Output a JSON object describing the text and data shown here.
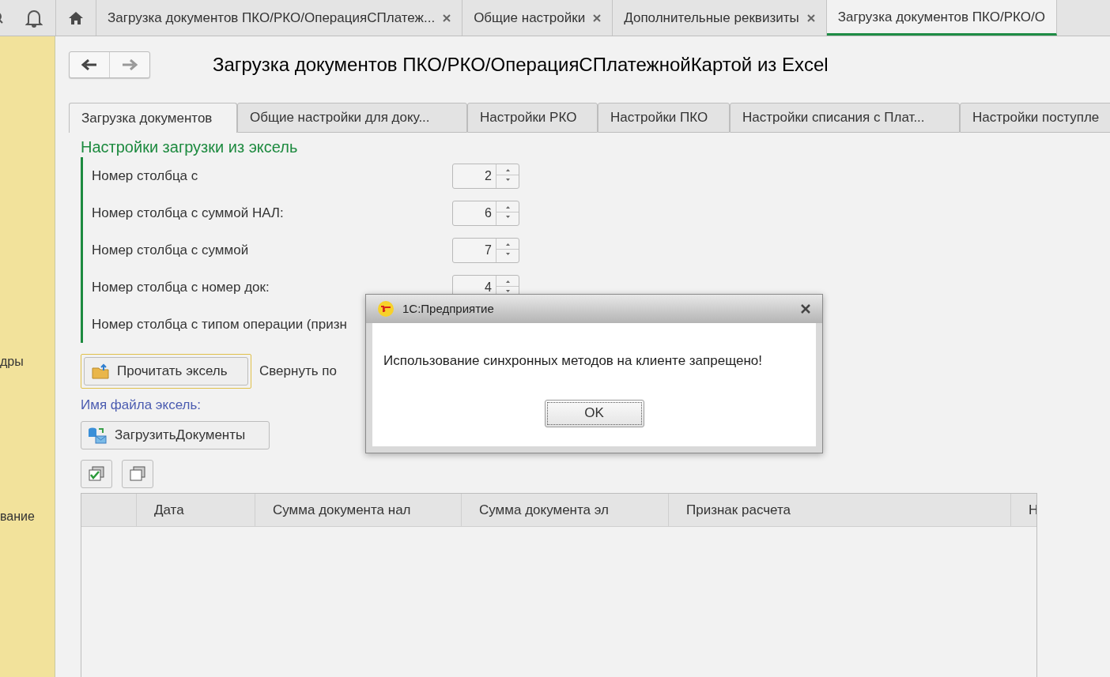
{
  "top_tabs": [
    {
      "label": "Загрузка документов ПКО/РКО/ОперацияСПлатеж...",
      "closable": true,
      "selected": false
    },
    {
      "label": "Общие настройки",
      "closable": true,
      "selected": false
    },
    {
      "label": "Дополнительные реквизиты",
      "closable": true,
      "selected": false
    },
    {
      "label": "Загрузка документов ПКО/РКО/О",
      "closable": false,
      "selected": true
    }
  ],
  "sidebar": {
    "items": [
      "дры",
      "вание"
    ]
  },
  "form": {
    "title": "Загрузка документов ПКО/РКО/ОперацияСПлатежнойКартой из Excel",
    "tabs": [
      {
        "label": "Загрузка документов",
        "selected": true
      },
      {
        "label": "Общие настройки для доку...",
        "selected": false
      },
      {
        "label": "Настройки РКО",
        "selected": false
      },
      {
        "label": "Настройки ПКО",
        "selected": false
      },
      {
        "label": "Настройки списания с Плат...",
        "selected": false
      },
      {
        "label": "Настройки поступле",
        "selected": false
      }
    ],
    "section_title": "Настройки загрузки из эксель",
    "fields": [
      {
        "label": "Номер столбца с",
        "value": "2"
      },
      {
        "label": "Номер столбца с суммой НАЛ:",
        "value": "6"
      },
      {
        "label": "Номер столбца с суммой",
        "value": "7"
      },
      {
        "label": "Номер столбца с номер док:",
        "value": "4"
      },
      {
        "label": "Номер столбца с типом операции (призн"
      }
    ],
    "read_button": {
      "label": "Прочитать эксель",
      "focused": true
    },
    "collapse_label": "Свернуть по",
    "file_label": "Имя файла эксель:",
    "load_button": "ЗагрузитьДокументы",
    "table": {
      "columns": [
        "",
        "Дата",
        "Сумма документа нал",
        "Сумма документа эл",
        "Признак расчета",
        "Н"
      ]
    }
  },
  "dialog": {
    "title": "1С:Предприятие",
    "message": "Использование синхронных методов на клиенте запрещено!",
    "button": "OK"
  }
}
